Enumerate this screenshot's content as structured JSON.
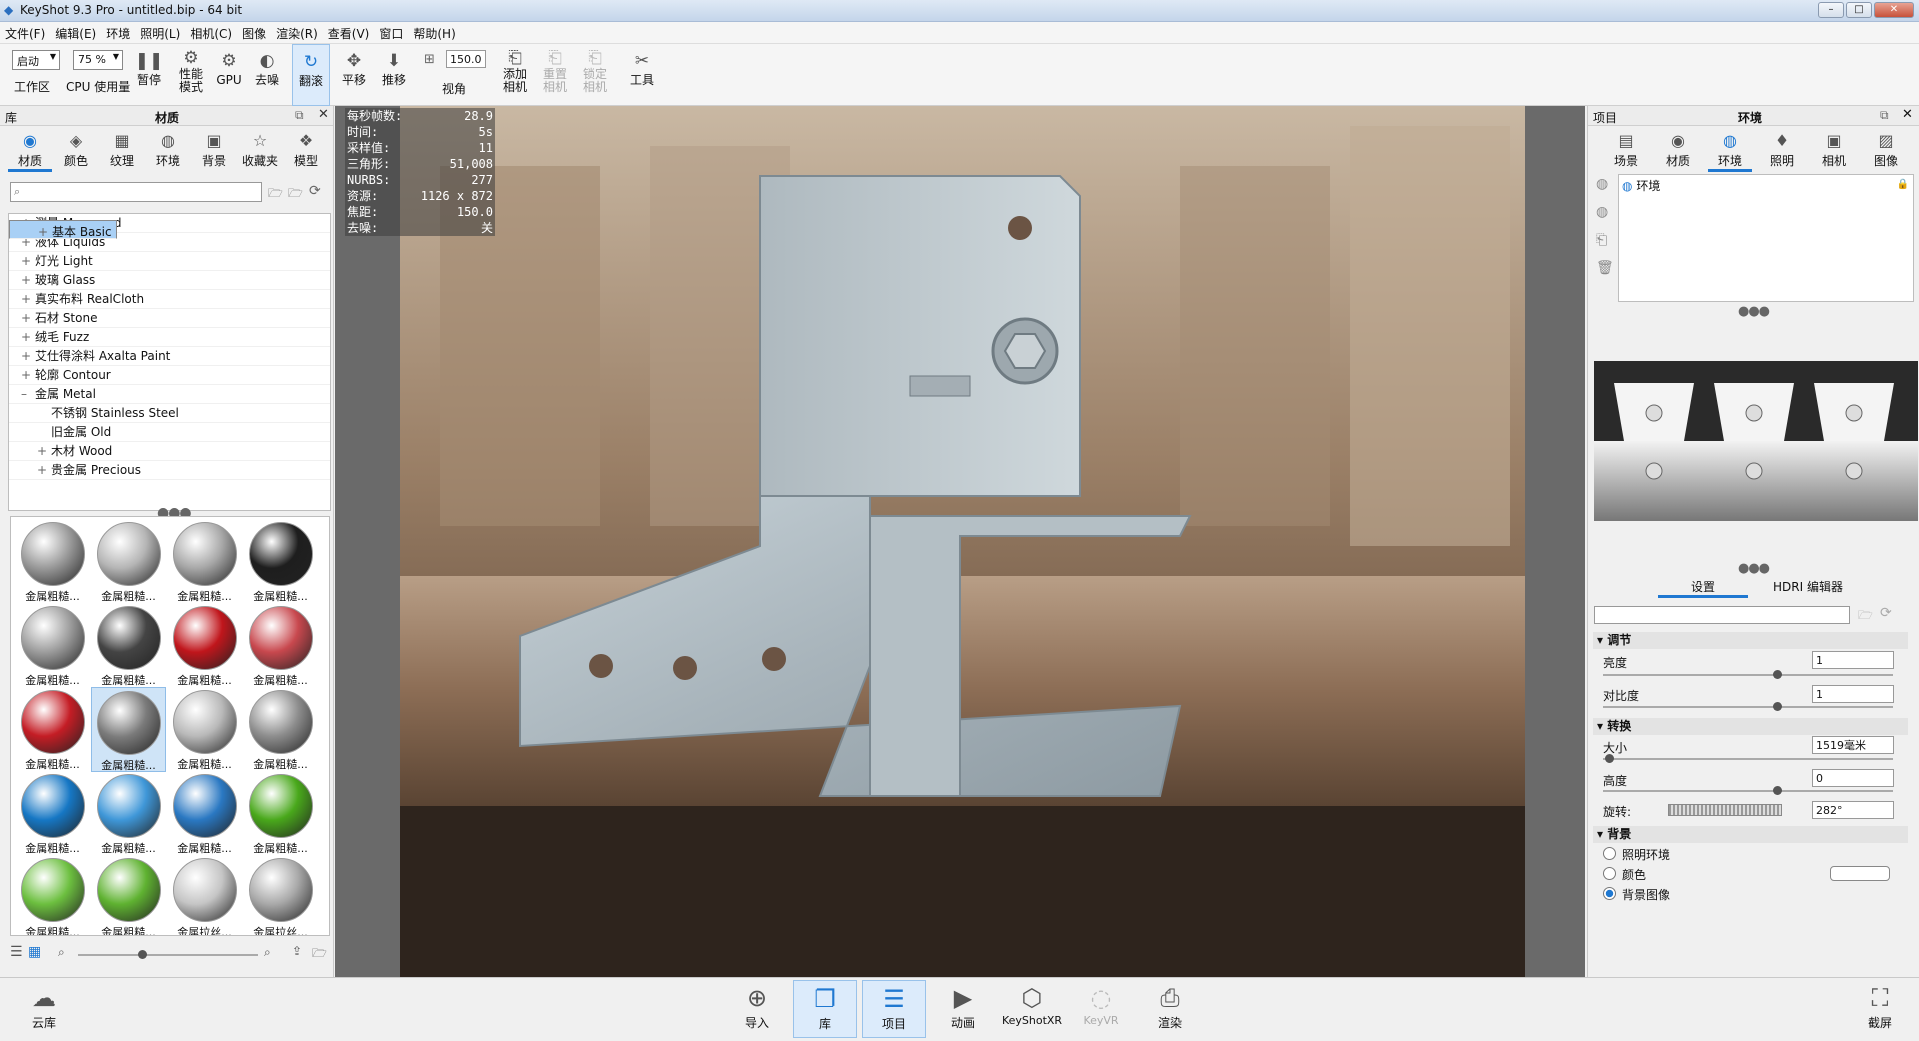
{
  "window": {
    "title": "KeyShot 9.3 Pro  - untitled.bip  - 64 bit",
    "min": "–",
    "max": "□",
    "close": "✕"
  },
  "menu": [
    "文件(F)",
    "编辑(E)",
    "环境",
    "照明(L)",
    "相机(C)",
    "图像",
    "渲染(R)",
    "查看(V)",
    "窗口",
    "帮助(H)"
  ],
  "toolbar": {
    "workspace_select": "启动",
    "workspace_label": "工作区",
    "cpu_select": "75 %",
    "cpu_label": "CPU 使用量",
    "pause_label": "暂停",
    "perf_label": "性能\n模式",
    "gpu_label": "GPU",
    "denoise_label": "去噪",
    "tumble_label": "翻滚",
    "pan_label": "平移",
    "dolly_label": "推移",
    "fov_value": "150.0",
    "fov_label": "视角",
    "add_cam_label": "添加\n相机",
    "reset_cam_label": "重置\n相机",
    "lock_cam_label": "锁定\n相机",
    "tools_label": "工具"
  },
  "library": {
    "header_left": "库",
    "header_title": "材质",
    "tabs": [
      {
        "icon": "◉",
        "label": "材质"
      },
      {
        "icon": "◈",
        "label": "颜色"
      },
      {
        "icon": "▦",
        "label": "纹理"
      },
      {
        "icon": "◍",
        "label": "环境"
      },
      {
        "icon": "▣",
        "label": "背景"
      },
      {
        "icon": "☆",
        "label": "收藏夹"
      },
      {
        "icon": "❖",
        "label": "模型"
      }
    ],
    "search_placeholder": "",
    "tree": [
      {
        "sign": "+",
        "label": "测量 Measured",
        "indent": 0
      },
      {
        "sign": "+",
        "label": "液体 Liquids",
        "indent": 0
      },
      {
        "sign": "+",
        "label": "灯光 Light",
        "indent": 0
      },
      {
        "sign": "+",
        "label": "玻璃 Glass",
        "indent": 0
      },
      {
        "sign": "+",
        "label": "真实布料 RealCloth",
        "indent": 0
      },
      {
        "sign": "+",
        "label": "石材 Stone",
        "indent": 0
      },
      {
        "sign": "+",
        "label": "绒毛 Fuzz",
        "indent": 0
      },
      {
        "sign": "+",
        "label": "艾仕得涂料 Axalta Paint",
        "indent": 0
      },
      {
        "sign": "+",
        "label": "轮廓 Contour",
        "indent": 0
      },
      {
        "sign": "–",
        "label": "金属 Metal",
        "indent": 0
      },
      {
        "sign": "",
        "label": "不锈钢 Stainless Steel",
        "indent": 1
      },
      {
        "sign": "+",
        "label": "基本 Basic",
        "indent": 1,
        "selected": true
      },
      {
        "sign": "",
        "label": "旧金属 Old",
        "indent": 1
      },
      {
        "sign": "+",
        "label": "木材 Wood",
        "indent": 1
      },
      {
        "sign": "+",
        "label": "贵金属 Precious",
        "indent": 1
      }
    ],
    "materials": [
      {
        "label": "金属粗糙...",
        "color": "#9a9a9a"
      },
      {
        "label": "金属粗糙...",
        "color": "#b5b5b5"
      },
      {
        "label": "金属粗糙...",
        "color": "#a8a8a8"
      },
      {
        "label": "金属粗糙...",
        "color": "#1e1e1e"
      },
      {
        "label": "金属粗糙...",
        "color": "#9d9d9d"
      },
      {
        "label": "金属粗糙...",
        "color": "#444444"
      },
      {
        "label": "金属粗糙...",
        "color": "#c0161c"
      },
      {
        "label": "金属粗糙...",
        "color": "#c8484e"
      },
      {
        "label": "金属粗糙...",
        "color": "#c41d25"
      },
      {
        "label": "金属粗糙...",
        "color": "#7b7b7b"
      },
      {
        "label": "金属粗糙...",
        "color": "#b9b9b9"
      },
      {
        "label": "金属粗糙...",
        "color": "#8e8e8e"
      },
      {
        "label": "金属粗糙...",
        "color": "#1677c4"
      },
      {
        "label": "金属粗糙...",
        "color": "#3f97d8"
      },
      {
        "label": "金属粗糙...",
        "color": "#2a78c2"
      },
      {
        "label": "金属粗糙...",
        "color": "#49a81b"
      },
      {
        "label": "金属粗糙...",
        "color": "#6cbf3f"
      },
      {
        "label": "金属粗糙...",
        "color": "#5fb231"
      },
      {
        "label": "金属拉丝...",
        "color": "#c5c5c5"
      },
      {
        "label": "金属拉丝...",
        "color": "#a9a9a9"
      }
    ],
    "selected_index": 9
  },
  "stats": [
    {
      "k": "每秒帧数:",
      "v": "28.9"
    },
    {
      "k": "时间:",
      "v": "5s"
    },
    {
      "k": "采样值:",
      "v": "11"
    },
    {
      "k": "三角形:",
      "v": "51,008"
    },
    {
      "k": "NURBS:",
      "v": "277"
    },
    {
      "k": "资源:",
      "v": "1126 x 872"
    },
    {
      "k": "焦距:",
      "v": "150.0"
    },
    {
      "k": "去噪:",
      "v": "关"
    }
  ],
  "project": {
    "header_left": "项目",
    "header_title": "环境",
    "tabs": [
      {
        "icon": "▤",
        "label": "场景"
      },
      {
        "icon": "◉",
        "label": "材质"
      },
      {
        "icon": "◍",
        "label": "环境"
      },
      {
        "icon": "♦",
        "label": "照明"
      },
      {
        "icon": "▣",
        "label": "相机"
      },
      {
        "icon": "▨",
        "label": "图像"
      }
    ],
    "env_item": "环境",
    "subtabs": [
      "设置",
      "HDRI 编辑器"
    ],
    "sections": {
      "adjust": "调节",
      "transform": "转换",
      "background": "背景"
    },
    "brightness": {
      "label": "亮度",
      "value": "1",
      "fraction": 0.6
    },
    "contrast": {
      "label": "对比度",
      "value": "1",
      "fraction": 0.6
    },
    "size": {
      "label": "大小",
      "value": "1519毫米",
      "fraction": 0.02
    },
    "height": {
      "label": "高度",
      "value": "0",
      "fraction": 0.6
    },
    "rotation": {
      "label": "旋转:",
      "value": "282°"
    },
    "bg_options": [
      {
        "label": "照明环境",
        "on": false
      },
      {
        "label": "颜色",
        "on": false
      },
      {
        "label": "背景图像",
        "on": true
      }
    ]
  },
  "bottom": {
    "cloud": "云库",
    "buttons": [
      {
        "icon": "⊕",
        "label": "导入"
      },
      {
        "icon": "📖",
        "label": "库",
        "on": true
      },
      {
        "icon": "☰",
        "label": "项目",
        "on": true
      },
      {
        "icon": "▶",
        "label": "动画"
      },
      {
        "icon": "⬡",
        "label": "KeyShotXR"
      },
      {
        "icon": "◌",
        "label": "KeyVR",
        "dis": true
      },
      {
        "icon": "⎙",
        "label": "渲染"
      }
    ],
    "screenshot": "截屏"
  }
}
